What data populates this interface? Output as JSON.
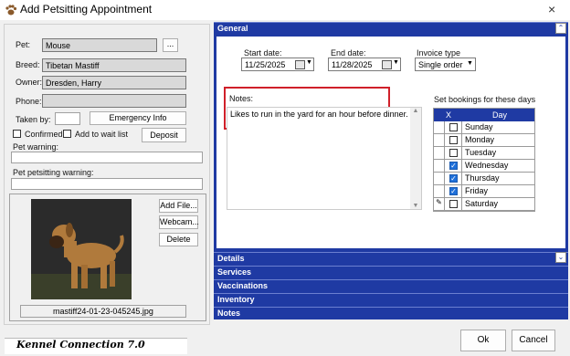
{
  "window": {
    "title": "Add Petsitting Appointment",
    "close": "×"
  },
  "pet": {
    "pet_label": "Pet:",
    "pet_value": "Mouse",
    "browse_label": "...",
    "breed_label": "Breed:",
    "breed_value": "Tibetan Mastiff",
    "owner_label": "Owner:",
    "owner_value": "Dresden, Harry",
    "phone_label": "Phone:",
    "taken_by_label": "Taken by:",
    "emergency_label": "Emergency Info",
    "confirmed_label": "Confirmed",
    "waitlist_label": "Add to wait list",
    "deposit_label": "Deposit",
    "pet_warning_label": "Pet warning:",
    "petsitting_warning_label": "Pet petsitting warning:",
    "photo_caption": "mastiff24-01-23-045245.jpg",
    "add_file_label": "Add File...",
    "webcam_label": "Webcam...",
    "delete_label": "Delete"
  },
  "general": {
    "header": "General",
    "start_label": "Start date:",
    "start_value": "11/25/2025",
    "end_label": "End date:",
    "end_value": "11/28/2025",
    "invoice_label": "Invoice type",
    "invoice_value": "Single order",
    "notes_label": "Notes:",
    "notes_value": "Likes to run in the yard for an hour before dinner.",
    "bookings_label": "Set bookings for these days",
    "grid_col_x": "X",
    "grid_col_day": "Day",
    "days": [
      {
        "name": "Sunday",
        "checked": false
      },
      {
        "name": "Monday",
        "checked": false
      },
      {
        "name": "Tuesday",
        "checked": false
      },
      {
        "name": "Wednesday",
        "checked": true
      },
      {
        "name": "Thursday",
        "checked": true
      },
      {
        "name": "Friday",
        "checked": true
      },
      {
        "name": "Saturday",
        "checked": false
      }
    ]
  },
  "sections": [
    "Details",
    "Services",
    "Vaccinations",
    "Inventory",
    "Notes"
  ],
  "footer": {
    "brand": "Kennel Connection 7.0",
    "ok_label": "Ok",
    "cancel_label": "Cancel"
  },
  "colors": {
    "section_blue": "#1f3aa3",
    "highlight_red": "#d0202a",
    "check_blue": "#1e6fd9"
  }
}
